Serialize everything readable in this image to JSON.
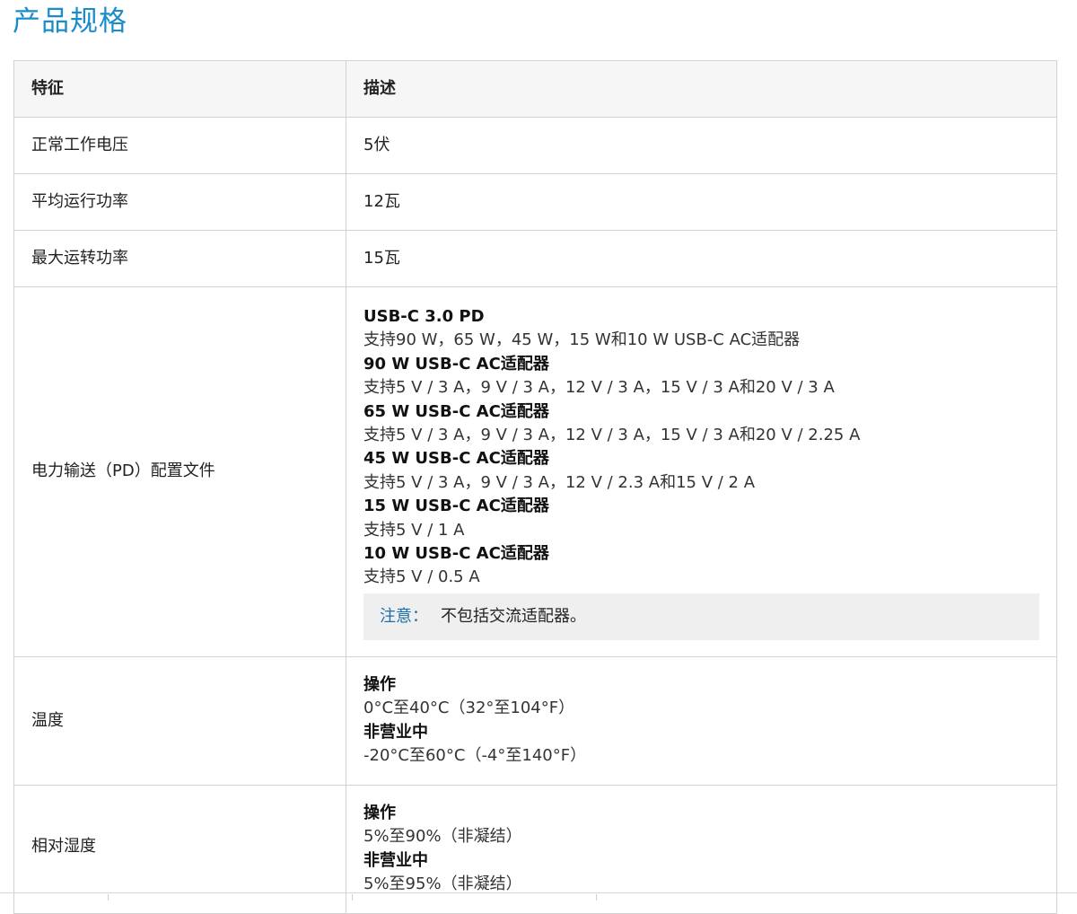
{
  "page": {
    "title": "产品规格"
  },
  "table": {
    "headers": [
      "特征",
      "描述"
    ],
    "rows": [
      {
        "feature": "正常工作电压",
        "description": "5伏"
      },
      {
        "feature": "平均运行功率",
        "description": "12瓦"
      },
      {
        "feature": "最大运转功率",
        "description": "15瓦"
      }
    ],
    "pd": {
      "feature": "电力输送（PD）配置文件",
      "lines": [
        "USB-C 3.0 PD",
        "支持90 W，65 W，45 W，15 W和10 W USB-C AC适配器",
        "90 W USB-C AC适配器",
        "支持5 V / 3 A，9 V / 3 A，12 V / 3 A，15 V / 3 A和20 V / 3 A",
        "65 W USB-C AC适配器",
        "支持5 V / 3 A，9 V / 3 A，12 V / 3 A，15 V / 3 A和20 V / 2.25 A",
        "45 W USB-C AC适配器",
        "支持5 V / 3 A，9 V / 3 A，12 V / 2.3 A和15 V / 2 A",
        "15 W USB-C AC适配器",
        "支持5 V / 1 A",
        "10 W USB-C AC适配器",
        "支持5 V / 0.5 A"
      ],
      "note_label": "注意：",
      "note_text": "不包括交流适配器。"
    },
    "temperature": {
      "feature": "温度",
      "operating_label": "操作",
      "operating_value": "0°C至40°C（32°至104°F）",
      "nonoperating_label": "非营业中",
      "nonoperating_value": "-20°C至60°C（-4°至140°F）"
    },
    "humidity": {
      "feature": "相对湿度",
      "operating_label": "操作",
      "operating_value": "5%至90%（非凝结）",
      "nonoperating_label": "非营业中",
      "nonoperating_value": "5%至95%（非凝结）"
    }
  }
}
